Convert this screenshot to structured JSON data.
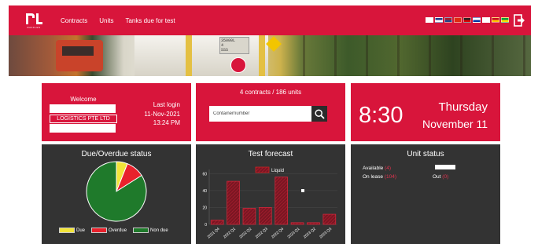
{
  "nav": {
    "brand_sub": "RAFFLES",
    "items": [
      "Contracts",
      "Units",
      "Tanks due for test"
    ],
    "languages": [
      {
        "code": "kr",
        "colors": [
          "#ffffff",
          "#ffffff"
        ]
      },
      {
        "code": "fr",
        "colors": [
          "#1f3c8b",
          "#ffffff"
        ]
      },
      {
        "code": "nl",
        "colors": [
          "#ae1c28",
          "#21468b"
        ]
      },
      {
        "code": "cn",
        "colors": [
          "#de2910",
          "#de2910"
        ]
      },
      {
        "code": "de",
        "colors": [
          "#222222",
          "#dd0000"
        ]
      },
      {
        "code": "ru",
        "colors": [
          "#ffffff",
          "#0039a6"
        ]
      },
      {
        "code": "jp",
        "colors": [
          "#ffffff",
          "#ffffff"
        ]
      },
      {
        "code": "es",
        "colors": [
          "#c60b1e",
          "#ffc400"
        ]
      },
      {
        "code": "br",
        "colors": [
          "#009c3b",
          "#ffdf00"
        ]
      }
    ]
  },
  "banner": {
    "plate_lines": [
      "35000L",
      "4",
      "SSS"
    ]
  },
  "welcome": {
    "title": "Welcome",
    "company": "LOGISTICS PTE LTD",
    "last_login_label": "Last login",
    "last_login_date": "11-Nov-2021",
    "last_login_time": "13:24 PM"
  },
  "contracts": {
    "summary": "4 contracts / 186 units",
    "search_placeholder": "Containernumber"
  },
  "clock": {
    "time": "8:30",
    "weekday": "Thursday",
    "date": "November 11"
  },
  "due_status": {
    "title": "Due/Overdue status",
    "legend": [
      {
        "label": "Due",
        "color": "#f2e43a"
      },
      {
        "label": "Overdue",
        "color": "#e8212c"
      },
      {
        "label": "Non due",
        "color": "#1f7a2b"
      }
    ],
    "chart_data": {
      "type": "pie",
      "labels": [
        "Due",
        "Overdue",
        "Non due"
      ],
      "values": [
        6,
        10,
        84
      ]
    }
  },
  "test_forecast": {
    "title": "Test forecast",
    "legend_label": "Liquid",
    "chart_data": {
      "type": "bar",
      "categories": [
        "2021 Q4",
        "2022 Q1",
        "2022 Q2",
        "2022 Q3",
        "2022 Q4",
        "2023 Q1",
        "2023 Q2",
        "2023 Q3"
      ],
      "series": [
        {
          "name": "Liquid",
          "values": [
            5,
            51,
            19,
            20,
            56,
            2,
            2,
            12
          ]
        }
      ],
      "yticks": [
        0,
        20,
        40,
        60
      ],
      "ylim": [
        0,
        65
      ]
    }
  },
  "unit_status": {
    "title": "Unit status",
    "available_label": "Available",
    "available_count": "(4)",
    "onlease_label": "On lease",
    "onlease_count": "(104)",
    "out_label": "Out",
    "out_count": "(0)"
  },
  "colors": {
    "brand_red": "#d8153b",
    "panel_dark": "#333333"
  },
  "icons": {
    "search": "magnifier-icon",
    "logout": "logout-icon"
  }
}
